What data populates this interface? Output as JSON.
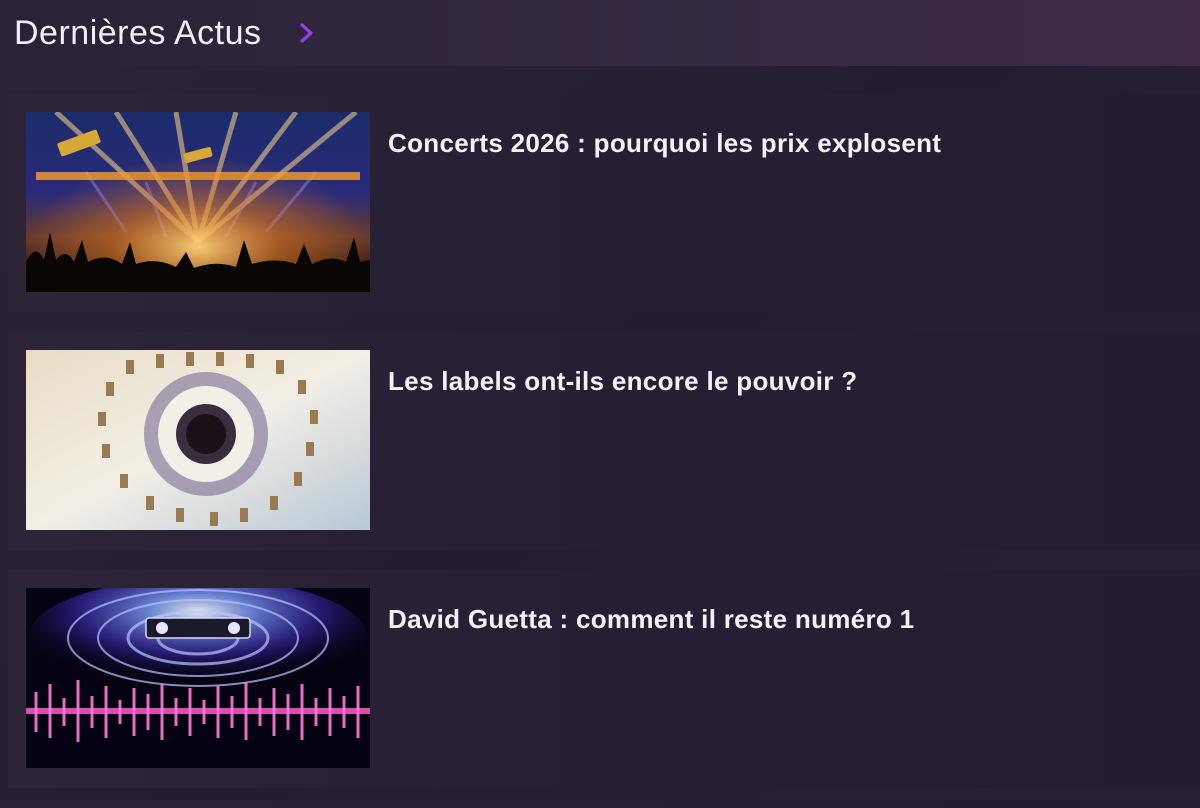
{
  "header": {
    "title": "Dernières Actus",
    "chevron_icon": "chevron-right-icon",
    "accent_color": "#9b3fe0"
  },
  "articles": [
    {
      "title": "Concerts 2026 : pourquoi les prix explosent",
      "image": "concert-stage-lights-image"
    },
    {
      "title": "Les labels ont-ils encore le pouvoir ?",
      "image": "mandala-price-tags-image"
    },
    {
      "title": "David Guetta : comment il reste numéro 1",
      "image": "dj-soundwave-image"
    }
  ]
}
